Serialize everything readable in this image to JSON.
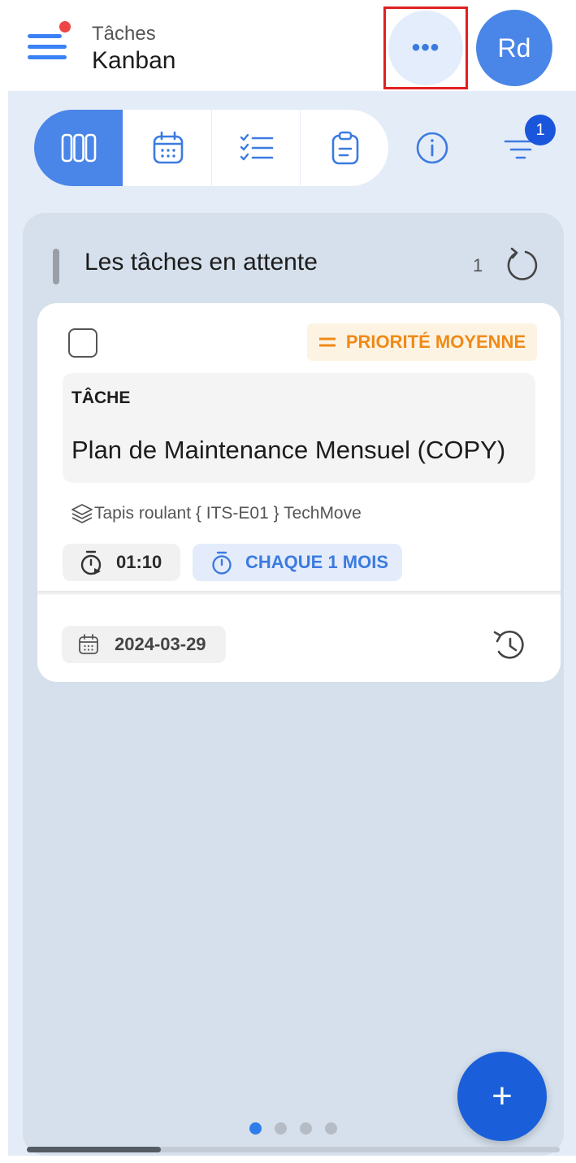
{
  "header": {
    "subtitle": "Tâches",
    "title": "Kanban",
    "more_label": "•••",
    "avatar_initials": "Rd"
  },
  "filter": {
    "badge_count": "1"
  },
  "column": {
    "title": "Les tâches en attente",
    "count": "1"
  },
  "card": {
    "priority_label": "PRIORITÉ MOYENNE",
    "type_label": "TÂCHE",
    "task_name": "Plan de Maintenance Mensuel (COPY)",
    "location": "Tapis roulant { ITS-E01 } TechMove",
    "duration": "01:10",
    "recurrence": "CHAQUE 1 MOIS",
    "date": "2024-03-29"
  },
  "fab_label": "+",
  "pagination": {
    "pages": 4,
    "current": 1
  },
  "colors": {
    "accent": "#4a86e8",
    "priority_medium": "#ef8a17",
    "notification": "#ef4444",
    "fab": "#1a5fd9"
  },
  "icons": [
    "menu-icon",
    "more-icon",
    "kanban-view-icon",
    "calendar-view-icon",
    "checklist-view-icon",
    "clipboard-view-icon",
    "info-icon",
    "filter-icon",
    "refresh-icon",
    "layers-icon",
    "timer-icon",
    "calendar-icon",
    "history-icon",
    "plus-icon"
  ]
}
